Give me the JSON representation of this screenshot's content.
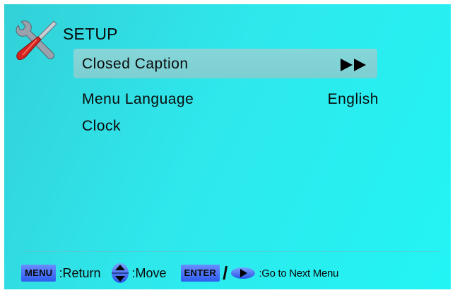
{
  "header": {
    "title": "SETUP",
    "icon": "tools-icon"
  },
  "menu": {
    "items": [
      {
        "label": "Closed Caption",
        "value": "",
        "selected": true,
        "indicator": "double-right-arrow-icon"
      },
      {
        "label": "Menu Language",
        "value": "English",
        "selected": false
      },
      {
        "label": "Clock",
        "value": "",
        "selected": false
      }
    ]
  },
  "footer": {
    "menu_key": "MENU",
    "return_label": ":Return",
    "move_label": ":Move",
    "enter_key": "ENTER",
    "slash": "/",
    "next_label": ":Go to Next Menu"
  },
  "colors": {
    "background": "#2ee8ec",
    "selected_row": "#7ccfd2",
    "key_button": "#2f5cf0",
    "key_text": "#0a0a0a"
  }
}
